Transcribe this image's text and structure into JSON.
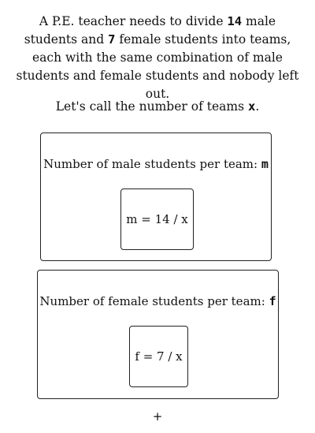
{
  "intro": {
    "part1": "A P.E. teacher needs to divide ",
    "male_count": "14",
    "part2": " male students and ",
    "female_count": "7",
    "part3": " female students into teams, each with the same combination of male students and female students and nobody left out."
  },
  "teams": {
    "prefix": "Let's call the number of teams ",
    "variable": "x",
    "suffix": "."
  },
  "male_card": {
    "label": "Number of male students per team: ",
    "variable": "m",
    "formula": "m = 14 / x"
  },
  "female_card": {
    "label": "Number of female students per team: ",
    "variable": "f",
    "formula": "f = 7 / x"
  },
  "add_symbol": "+"
}
